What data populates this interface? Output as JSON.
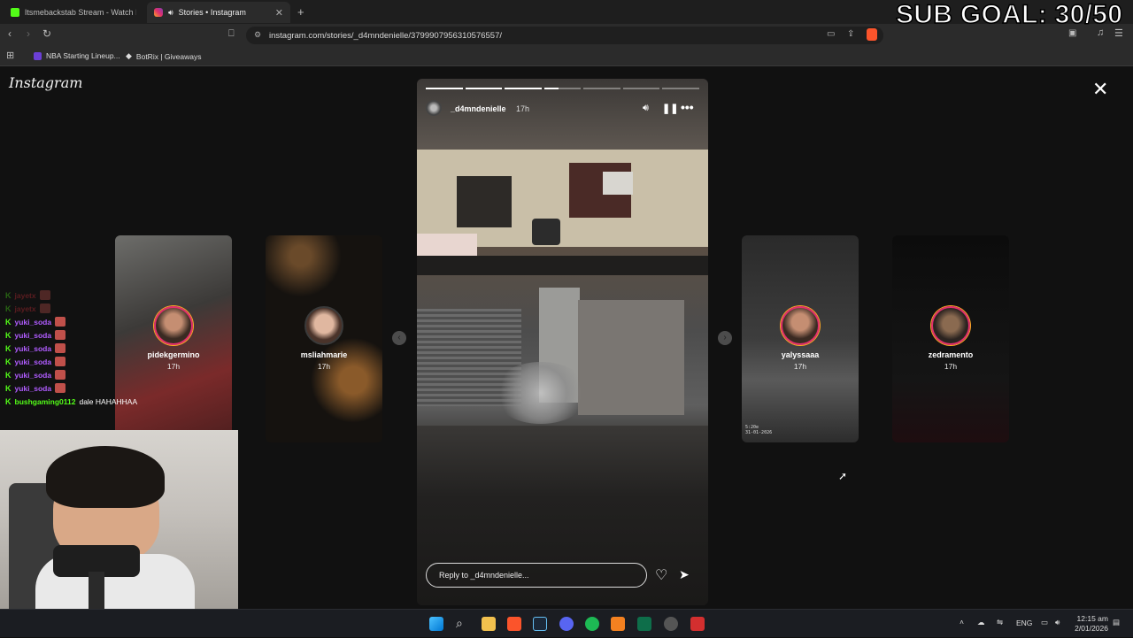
{
  "browser": {
    "tabs": [
      {
        "title": "Itsmebackstab Stream - Watch Live o",
        "active": false
      },
      {
        "title": "Stories • Instagram",
        "active": true
      }
    ],
    "url": "instagram.com/stories/_d4mndenielle/3799907956310576557/",
    "bookmarks": [
      "NBA Starting Lineup...",
      "BotRix | Giveaways"
    ]
  },
  "overlay": {
    "sub_goal": "SUB GOAL: 30/50"
  },
  "instagram": {
    "logo": "Instagram",
    "story": {
      "username": "_d4mndenielle",
      "time": "17h",
      "reply_placeholder": "Reply to _d4mndenielle...",
      "progress": [
        1,
        1,
        1,
        0.4,
        0,
        0,
        0
      ]
    },
    "previews": [
      {
        "username": "pidekgermino",
        "time": "17h"
      },
      {
        "username": "msliahmarie",
        "time": "17h"
      },
      {
        "username": "yalyssaaa",
        "time": "17h"
      },
      {
        "username": "zedramento",
        "time": "17h"
      }
    ],
    "timestamp_overlay": "5:20e\n31-01-2026"
  },
  "chat": [
    {
      "user": "jayetx",
      "message": "",
      "color": "#e0303a"
    },
    {
      "user": "jayetx",
      "message": "",
      "color": "#e0303a"
    },
    {
      "user": "yuki_soda",
      "message": "",
      "color": "#b05cff"
    },
    {
      "user": "yuki_soda",
      "message": "",
      "color": "#b05cff"
    },
    {
      "user": "yuki_soda",
      "message": "",
      "color": "#b05cff"
    },
    {
      "user": "yuki_soda",
      "message": "",
      "color": "#b05cff"
    },
    {
      "user": "yuki_soda",
      "message": "",
      "color": "#b05cff"
    },
    {
      "user": "yuki_soda",
      "message": "",
      "color": "#b05cff"
    },
    {
      "user": "bushgaming0112",
      "message": "dale HAHAHHAA",
      "color": "#53fc18"
    }
  ],
  "taskbar": {
    "lang": "ENG",
    "time": "12:15 am",
    "date": "2/01/2026"
  }
}
